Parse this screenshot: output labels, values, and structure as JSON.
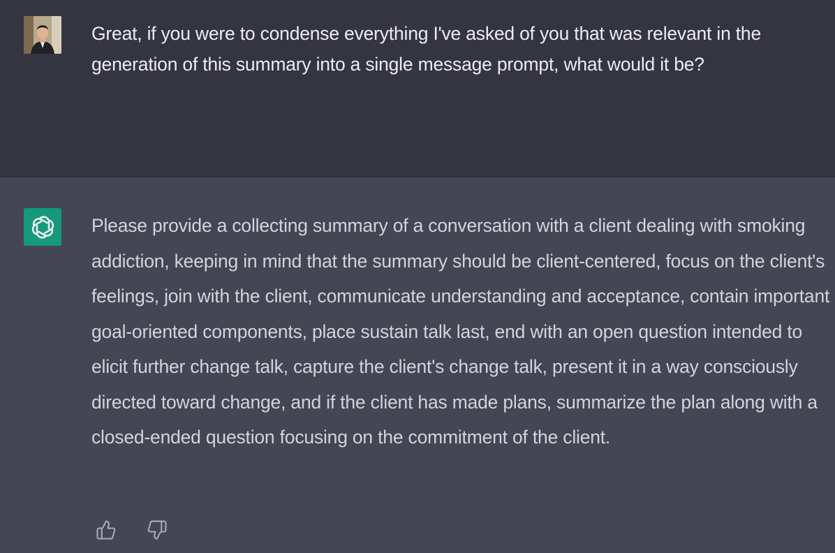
{
  "conversation": {
    "user_message": {
      "avatar_icon": "user-photo-avatar",
      "text": "Great, if you were to condense everything I've asked of you that was relevant in the generation of this summary into a single message prompt, what would it be?"
    },
    "assistant_message": {
      "avatar_icon": "openai-logo-icon",
      "avatar_color": "#10a37f",
      "text": "Please provide a collecting summary of a conversation with a client dealing with smoking addiction, keeping in mind that the summary should be client-centered, focus on the client's feelings, join with the client, communicate understanding and acceptance, contain important goal-oriented components, place sustain talk last, end with an open question intended to elicit further change talk, capture the client's change talk, present it in a way consciously directed toward change, and if the client has made plans, summarize the plan along with a closed-ended question focusing on the commitment of the client."
    },
    "feedback": {
      "like_icon": "thumbs-up-icon",
      "dislike_icon": "thumbs-down-icon"
    }
  },
  "colors": {
    "user_bg": "#343541",
    "assistant_bg": "#444654",
    "user_text": "#ececf1",
    "assistant_text": "#d1d5db",
    "icon": "#acacbe"
  }
}
